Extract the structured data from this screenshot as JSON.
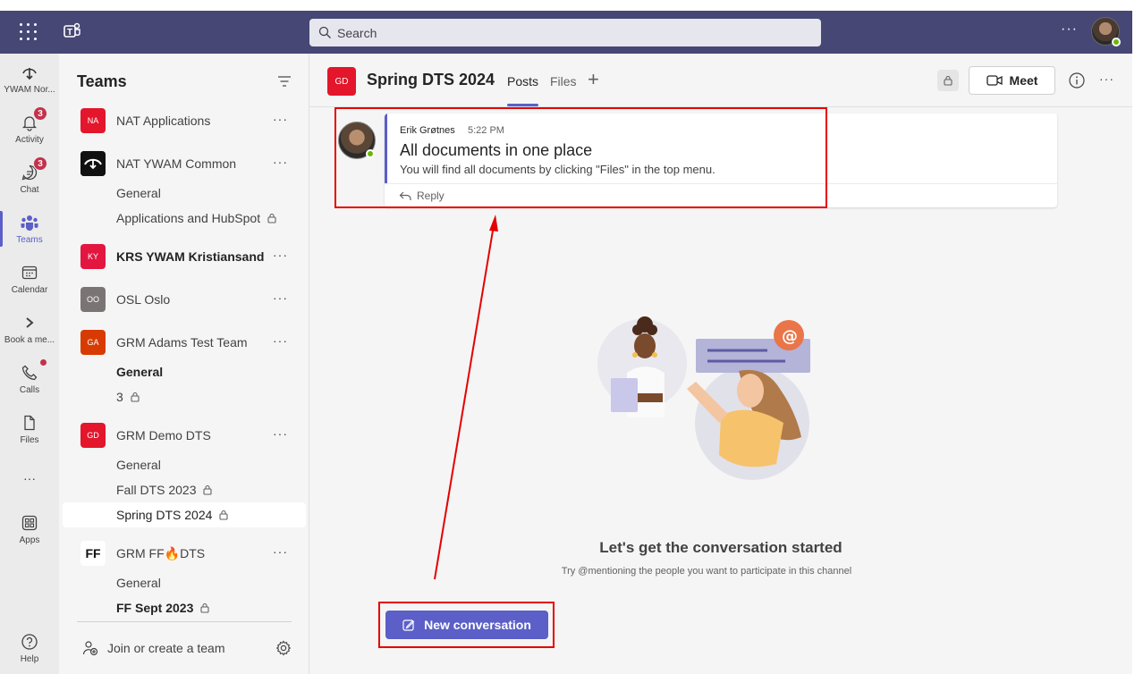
{
  "header": {
    "search_placeholder": "Search",
    "more_label": "···"
  },
  "rail": {
    "items": [
      {
        "label": "YWAM Nor...",
        "icon": "org-logo-icon"
      },
      {
        "label": "Activity",
        "icon": "bell-icon",
        "badge": "3"
      },
      {
        "label": "Chat",
        "icon": "chat-icon",
        "badge": "3"
      },
      {
        "label": "Teams",
        "icon": "teams-icon"
      },
      {
        "label": "Calendar",
        "icon": "calendar-icon"
      },
      {
        "label": "Book a me...",
        "icon": "bookings-icon"
      },
      {
        "label": "Calls",
        "icon": "phone-icon"
      },
      {
        "label": "Files",
        "icon": "file-icon"
      },
      {
        "label": "···",
        "icon": "more-icon"
      },
      {
        "label": "Apps",
        "icon": "apps-icon"
      },
      {
        "label": "Help",
        "icon": "help-icon"
      }
    ]
  },
  "teams_panel": {
    "title": "Teams",
    "teams": [
      {
        "abbr": "NA",
        "name": "NAT Applications",
        "color": "#e3162b"
      },
      {
        "abbr": "",
        "name": "NAT YWAM Common",
        "color": "#111111"
      },
      {
        "abbr": "KY",
        "name": "KRS YWAM Kristiansand",
        "color": "#e3163f"
      },
      {
        "abbr": "OO",
        "name": "OSL Oslo",
        "color": "#7a7574"
      },
      {
        "abbr": "GA",
        "name": "GRM Adams Test Team",
        "color": "#d83b01"
      },
      {
        "abbr": "GD",
        "name": "GRM Demo DTS",
        "color": "#e3162b"
      },
      {
        "abbr": "FF",
        "name": "GRM FF🔥DTS",
        "color": "#ffffff"
      }
    ],
    "channels": {
      "nat_common": [
        "General",
        "Applications and HubSpot"
      ],
      "adams": [
        "General",
        "3"
      ],
      "demo": [
        "General",
        "Fall DTS 2023",
        "Spring DTS 2024"
      ],
      "ff": [
        "General",
        "FF Sept 2023"
      ]
    },
    "join_label": "Join or create a team"
  },
  "channel": {
    "avatar": "GD",
    "title": "Spring DTS 2024",
    "tabs": [
      "Posts",
      "Files"
    ],
    "meet_label": "Meet"
  },
  "post": {
    "author": "Erik Grøtnes",
    "time": "5:22 PM",
    "subject": "All documents in one place",
    "body": "You will find all documents by clicking \"Files\" in the top menu.",
    "reply_label": "Reply"
  },
  "empty_state": {
    "title": "Let's get the conversation started",
    "subtitle": "Try @mentioning the people you want to participate in this channel",
    "button": "New conversation"
  },
  "colors": {
    "header": "#464775",
    "accent": "#5b5fc7",
    "annotation": "#e50000"
  }
}
